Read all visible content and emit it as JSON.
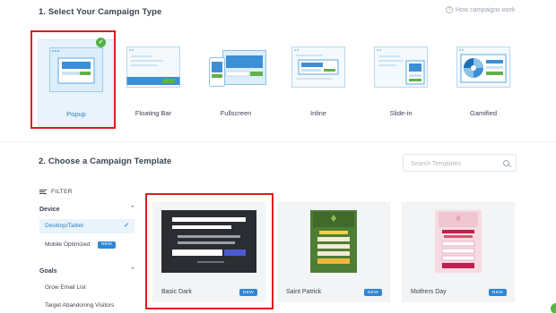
{
  "section1": {
    "title": "1. Select Your Campaign Type",
    "help_link": "How campaigns work"
  },
  "campaign_types": [
    {
      "label": "Popup",
      "selected": true
    },
    {
      "label": "Floating Bar",
      "selected": false
    },
    {
      "label": "Fullscreen",
      "selected": false
    },
    {
      "label": "Inline",
      "selected": false
    },
    {
      "label": "Slide-in",
      "selected": false
    },
    {
      "label": "Gamified",
      "selected": false
    }
  ],
  "section2": {
    "title": "2. Choose a Campaign Template",
    "search_placeholder": "Search Templates"
  },
  "filter": {
    "label": "FILTER",
    "device": {
      "title": "Device",
      "items": [
        {
          "label": "Desktop/Tablet",
          "active": true
        },
        {
          "label": "Mobile Optimized",
          "badge": "NEW"
        }
      ]
    },
    "goals": {
      "title": "Goals",
      "items": [
        {
          "label": "Grow Email List"
        },
        {
          "label": "Target Abandoning Visitors"
        }
      ]
    }
  },
  "templates": [
    {
      "name": "Basic Dark",
      "badge": "NEW"
    },
    {
      "name": "Saint Patrick",
      "badge": "NEW"
    },
    {
      "name": "Mothers Day",
      "badge": "NEW"
    }
  ],
  "colors": {
    "accent": "#2f86d6",
    "highlight_box": "#e0191e",
    "selected_check": "#53b045"
  }
}
